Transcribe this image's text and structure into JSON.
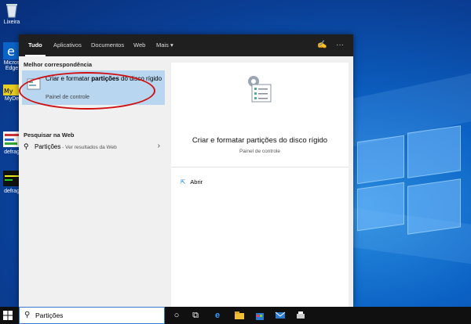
{
  "desktop": {
    "icons": [
      {
        "label": "Lixeira",
        "icon": "recycle-bin-icon"
      },
      {
        "label": "Micros Edge",
        "icon": "edge-icon"
      },
      {
        "label": "MyDe",
        "icon": "mydefrag-icon"
      },
      {
        "label": "defrag",
        "icon": "defrag-icon"
      },
      {
        "label": "defrag",
        "icon": "defrag-icon"
      }
    ]
  },
  "search_panel": {
    "tabs": [
      "Tudo",
      "Aplicativos",
      "Documentos",
      "Web",
      "Mais"
    ],
    "active_tab": "Tudo",
    "best_match_heading": "Melhor correspondência",
    "best_match": {
      "title_pre": "Criar e formatar ",
      "title_bold": "partições",
      "title_post": " do disco rígido",
      "subtitle": "Painel de controle",
      "icon": "disk-management-icon"
    },
    "web_heading": "Pesquisar na Web",
    "web_result": {
      "term": "Partições",
      "suffix": " - Ver resultados da Web"
    },
    "detail": {
      "title": "Criar e formatar partições do disco rígido",
      "subtitle": "Painel de controle",
      "action": "Abrir"
    }
  },
  "taskbar": {
    "search_value": "Partições",
    "icons": [
      "cortana-icon",
      "task-view-icon",
      "edge-icon",
      "file-explorer-icon",
      "store-icon",
      "mail-icon",
      "printer-icon"
    ]
  },
  "colors": {
    "accent": "#0078d7",
    "highlight": "#b8d6f0",
    "annotation": "#d01010"
  }
}
